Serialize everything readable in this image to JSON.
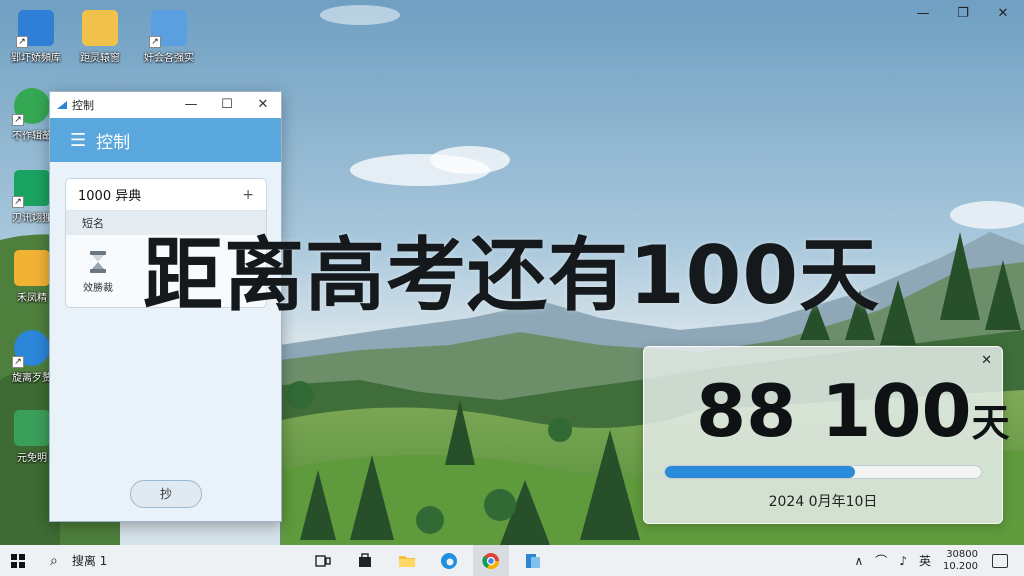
{
  "desktop": {
    "window_controls": {
      "minimize": "—",
      "restore": "❐",
      "close": "✕"
    },
    "icons": [
      {
        "label": "郢圷娇頻库",
        "color": "#2f7fd6"
      },
      {
        "label": "距灵辕窗",
        "color": "#f0c14b"
      },
      {
        "label": "奸会各强实",
        "color": "#5aa0e0"
      },
      {
        "label": "不作辑蘸",
        "color": "#34a853"
      },
      {
        "label": "刃讯翊狸",
        "color": "#1aa260"
      },
      {
        "label": "禾凤精",
        "color": "#f2b233"
      },
      {
        "label": "旋离歹赘",
        "color": "#2b86d8"
      },
      {
        "label": "元免明",
        "color": "#3a9f5a"
      }
    ]
  },
  "app_window": {
    "title": "控制",
    "controls": {
      "minimize": "—",
      "maximize": "☐",
      "close": "✕"
    },
    "header": {
      "menu_icon": "☰",
      "title": "控制"
    },
    "card": {
      "value": "1000 异典",
      "plus": "+",
      "section": "短名",
      "item_label": "效勝裁"
    },
    "button_label": "抄"
  },
  "headline": "距离高考还有100天",
  "widget": {
    "close": "✕",
    "count": "88 100",
    "unit": "天",
    "progress": 0.6,
    "date": "2024 0月年10日",
    "accent": "#2a8bd8"
  },
  "taskbar": {
    "search_icon": "⌕",
    "search_text": "搜离 1",
    "apps": [
      {
        "name": "task-view"
      },
      {
        "name": "store"
      },
      {
        "name": "file-explorer"
      },
      {
        "name": "edge"
      },
      {
        "name": "chrome"
      },
      {
        "name": "app-active"
      }
    ],
    "tray": {
      "chevron": "∧",
      "wifi": "⌒",
      "volume": "♪",
      "ime": "英"
    },
    "clock": {
      "time": "30800",
      "date": "10.200"
    }
  }
}
